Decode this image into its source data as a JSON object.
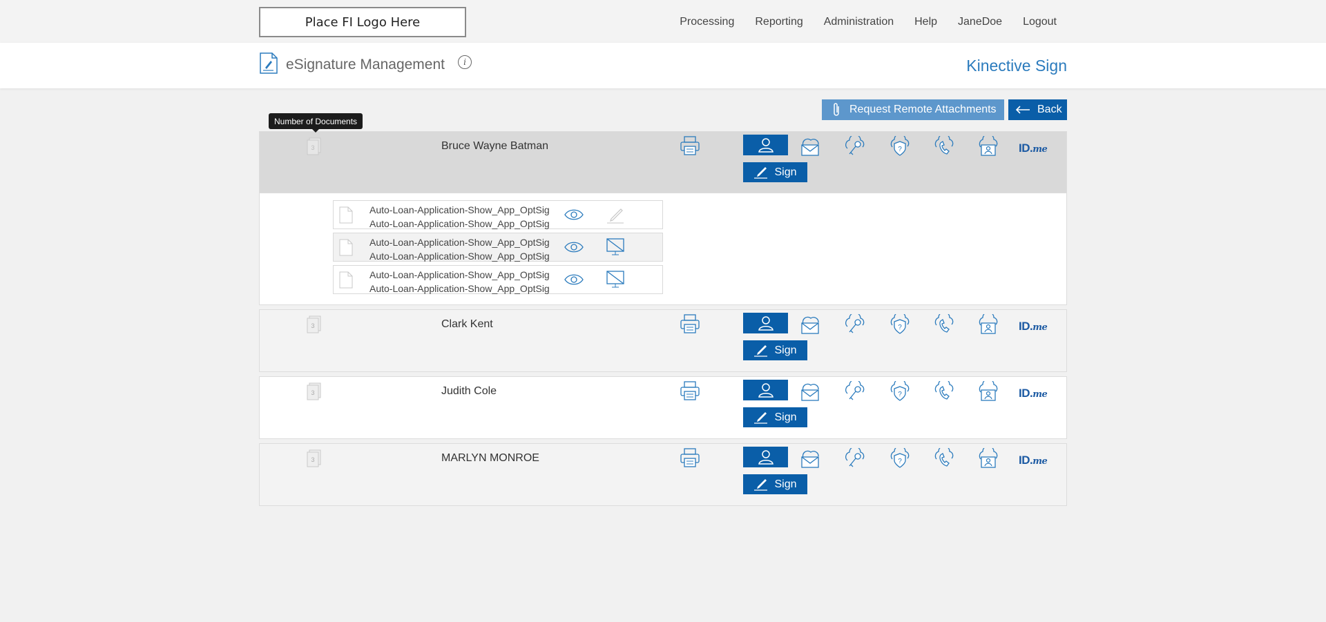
{
  "header": {
    "logo_text": "Place FI Logo Here",
    "nav": [
      "Processing",
      "Reporting",
      "Administration",
      "Help",
      "JaneDoe",
      "Logout"
    ]
  },
  "title": {
    "app_title": "eSignature Management",
    "info_glyph": "i",
    "brand": "Kinective Sign"
  },
  "actions": {
    "request_attachments": "Request Remote Attachments",
    "back": "Back"
  },
  "tooltip": "Number of Documents",
  "signers": [
    {
      "name": "Bruce Wayne Batman",
      "doc_count": "3"
    },
    {
      "name": "Clark Kent",
      "doc_count": "3"
    },
    {
      "name": "Judith Cole",
      "doc_count": "3"
    },
    {
      "name": "MARLYN MONROE",
      "doc_count": "3"
    }
  ],
  "sign_label": "Sign",
  "idme": {
    "main": "ID.",
    "sub": "me"
  },
  "auth_icons": [
    "person-icon",
    "email-cloud-icon",
    "key-cloud-icon",
    "question-shield-icon",
    "phone-cloud-icon",
    "id-cloud-icon",
    "idme-logo"
  ],
  "documents": [
    {
      "line1": "Auto-Loan-Application-Show_App_OptSig",
      "line2": "Auto-Loan-Application-Show_App_OptSig",
      "action_icon": "pen-icon"
    },
    {
      "line1": "Auto-Loan-Application-Show_App_OptSig",
      "line2": "Auto-Loan-Application-Show_App_OptSig",
      "action_icon": "no-screen-icon"
    },
    {
      "line1": "Auto-Loan-Application-Show_App_OptSig",
      "line2": "Auto-Loan-Application-Show_App_OptSig",
      "action_icon": "no-screen-icon"
    }
  ],
  "colors": {
    "primary": "#0a5ea8",
    "secondary": "#5d97cc",
    "brand": "#2b7bbd"
  }
}
